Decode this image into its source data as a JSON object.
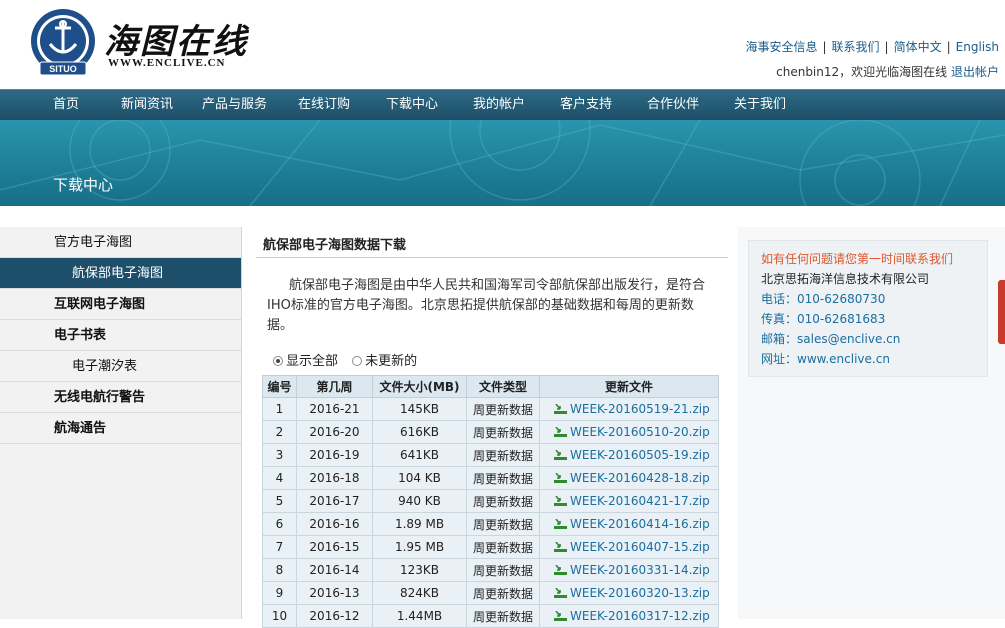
{
  "brand": {
    "name": "海图在线",
    "url": "WWW.ENCLIVE.CN",
    "emblem_text": "SITUO"
  },
  "top_links": [
    "海事安全信息",
    "联系我们",
    "简体中文",
    "English"
  ],
  "welcome": {
    "text": "chenbin12，欢迎光临海图在线",
    "logout": "退出帐户"
  },
  "nav": [
    "首页",
    "新闻资讯",
    "产品与服务",
    "在线订购",
    "下载中心",
    "我的帐户",
    "客户支持",
    "合作伙伴",
    "关于我们"
  ],
  "banner": {
    "title": "下载中心"
  },
  "sidebar": [
    {
      "label": "官方电子海图",
      "level": 1,
      "bold": false,
      "active": false
    },
    {
      "label": "航保部电子海图",
      "level": 2,
      "bold": false,
      "active": true
    },
    {
      "label": "互联网电子海图",
      "level": 1,
      "bold": true,
      "active": false
    },
    {
      "label": "电子书表",
      "level": 1,
      "bold": true,
      "active": false
    },
    {
      "label": "电子潮汐表",
      "level": 2,
      "bold": false,
      "active": false
    },
    {
      "label": "无线电航行警告",
      "level": 1,
      "bold": true,
      "active": false
    },
    {
      "label": "航海通告",
      "level": 1,
      "bold": true,
      "active": false
    }
  ],
  "main": {
    "title": "航保部电子海图数据下载",
    "intro": "航保部电子海图是由中华人民共和国海军司令部航保部出版发行，是符合IHO标准的官方电子海图。北京思拓提供航保部的基础数据和每周的更新数据。",
    "filters": [
      {
        "label": "显示全部",
        "checked": true
      },
      {
        "label": "未更新的",
        "checked": false
      }
    ],
    "table": {
      "columns": [
        "编号",
        "第几周",
        "文件大小(MB)",
        "文件类型",
        "更新文件"
      ],
      "rows": [
        [
          "1",
          "2016-21",
          "145KB",
          "周更新数据",
          "WEEK-20160519-21.zip"
        ],
        [
          "2",
          "2016-20",
          "616KB",
          "周更新数据",
          "WEEK-20160510-20.zip"
        ],
        [
          "3",
          "2016-19",
          "641KB",
          "周更新数据",
          "WEEK-20160505-19.zip"
        ],
        [
          "4",
          "2016-18",
          "104 KB",
          "周更新数据",
          "WEEK-20160428-18.zip"
        ],
        [
          "5",
          "2016-17",
          "940 KB",
          "周更新数据",
          "WEEK-20160421-17.zip"
        ],
        [
          "6",
          "2016-16",
          "1.89 MB",
          "周更新数据",
          "WEEK-20160414-16.zip"
        ],
        [
          "7",
          "2016-15",
          "1.95 MB",
          "周更新数据",
          "WEEK-20160407-15.zip"
        ],
        [
          "8",
          "2016-14",
          "123KB",
          "周更新数据",
          "WEEK-20160331-14.zip"
        ],
        [
          "9",
          "2016-13",
          "824KB",
          "周更新数据",
          "WEEK-20160320-13.zip"
        ],
        [
          "10",
          "2016-12",
          "1.44MB",
          "周更新数据",
          "WEEK-20160317-12.zip"
        ]
      ]
    }
  },
  "contact": {
    "title": "如有任何问题请您第一时间联系我们",
    "company": "北京思拓海洋信息技术有限公司",
    "lines": [
      {
        "label": "电话：",
        "value": "010-62680730"
      },
      {
        "label": "传真：",
        "value": "010-62681683"
      },
      {
        "label": "邮箱：",
        "value": "sales@enclive.cn"
      },
      {
        "label": "网址：",
        "value": "www.enclive.cn"
      }
    ]
  },
  "colors": {
    "nav_bg": "#1d4e66",
    "banner_bg": "#1e7f98",
    "sidebar_active": "#1e4f6a",
    "link": "#1a6e9e",
    "contact_title": "#e0562d"
  }
}
